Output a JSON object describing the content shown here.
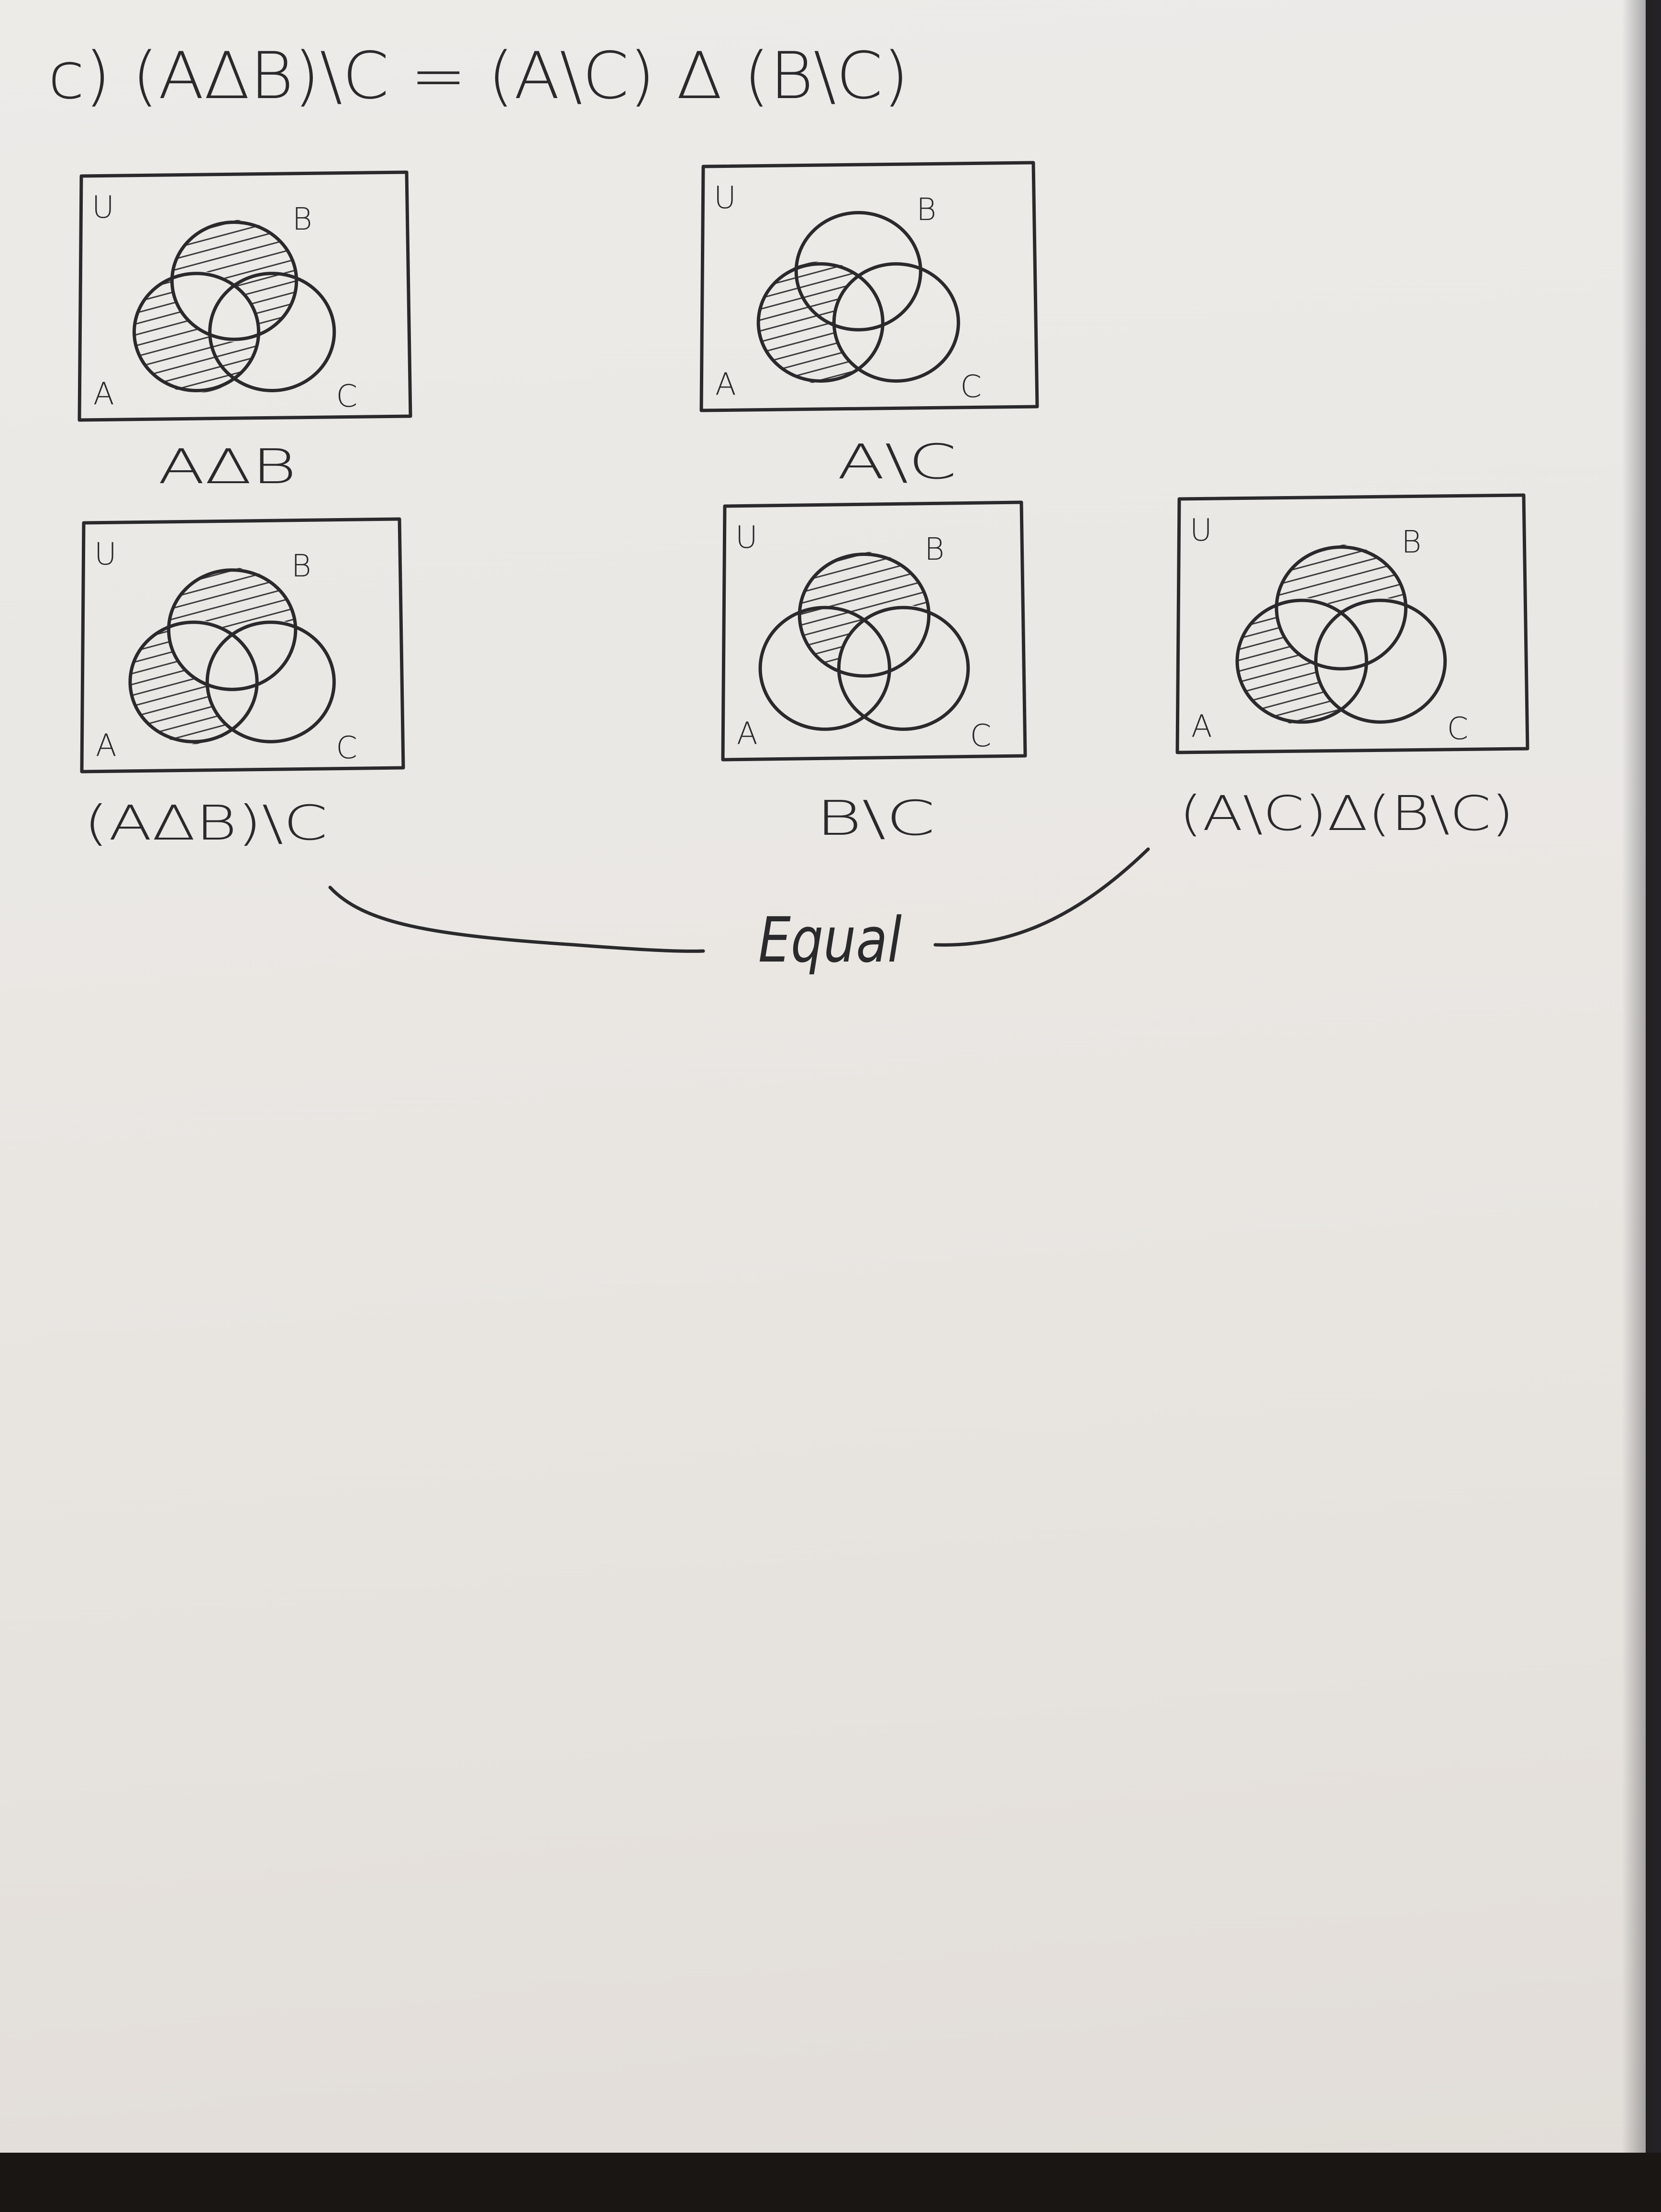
{
  "title": "c) (AΔB)\\C = (A\\C) Δ (B\\C)",
  "universe_label": "U",
  "set_labels": {
    "a": "A",
    "b": "B",
    "c": "C"
  },
  "diagrams": [
    {
      "id": "a-sym-diff-b",
      "caption": "AΔB",
      "shaded_regions": [
        "A only",
        "B only",
        "A∩C only",
        "B∩C only"
      ]
    },
    {
      "id": "a-minus-c",
      "caption": "A\\C",
      "shaded_regions": [
        "A only",
        "A∩B only"
      ]
    },
    {
      "id": "a-sym-diff-b-minus-c",
      "caption": "(AΔB)\\C",
      "shaded_regions": [
        "A only",
        "B only"
      ]
    },
    {
      "id": "b-minus-c",
      "caption": "B\\C",
      "shaded_regions": [
        "B only",
        "A∩B only"
      ]
    },
    {
      "id": "a-minus-c-sym-diff-b-minus-c",
      "caption": "(A\\C)Δ(B\\C)",
      "shaded_regions": [
        "A only",
        "B only"
      ]
    }
  ],
  "conclusion": "Equal",
  "ink_color": "#2a2a2c",
  "paper_color": "#ebe8e4"
}
